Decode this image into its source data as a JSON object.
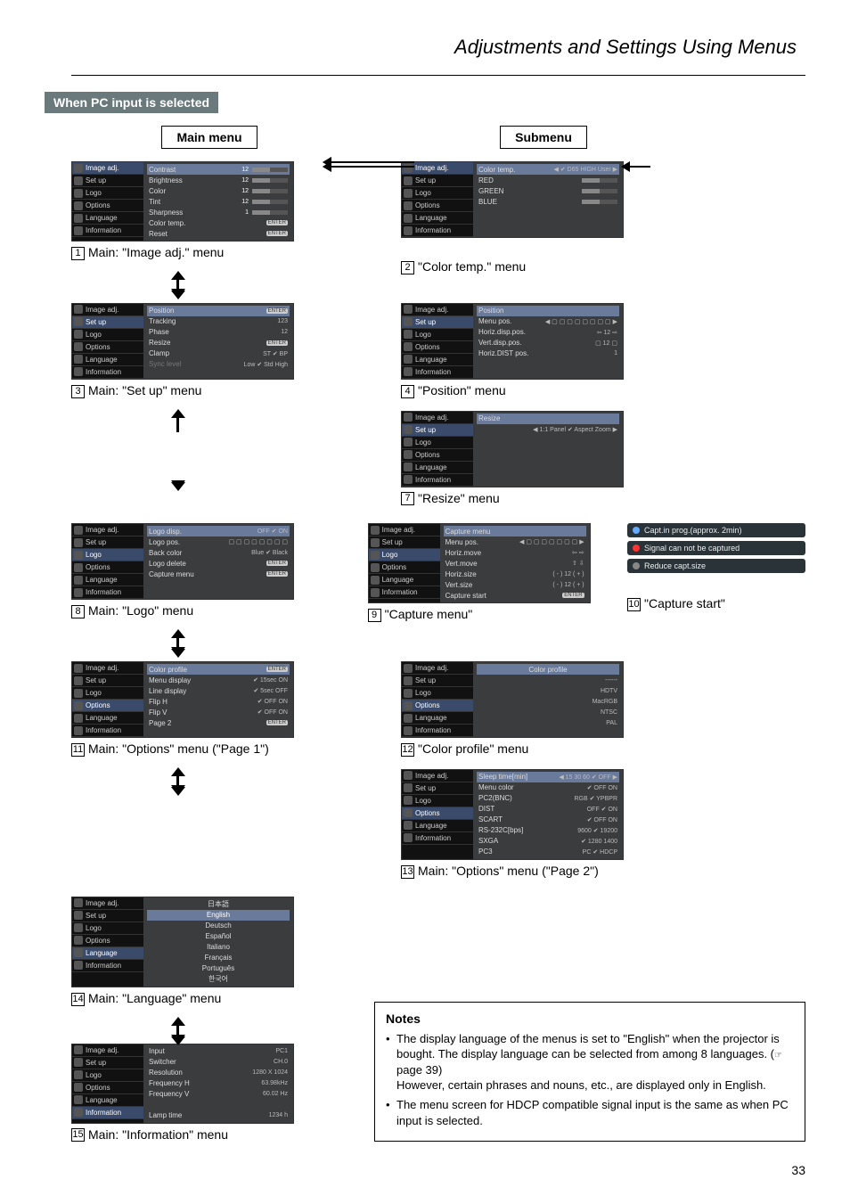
{
  "doc": {
    "header_title": "Adjustments and Settings Using Menus",
    "section": "When PC input is selected",
    "main_menu_label": "Main menu",
    "submenu_label": "Submenu",
    "page_number": "33"
  },
  "sidebar_items": [
    "Image adj.",
    "Set up",
    "Logo",
    "Options",
    "Language",
    "Information"
  ],
  "panels": {
    "p1": {
      "cap": "Main: \"Image adj.\" menu",
      "sel": 0,
      "rows": [
        {
          "l": "Contrast",
          "v": "12",
          "bar": true,
          "sel": true
        },
        {
          "l": "Brightness",
          "v": "12",
          "bar": true
        },
        {
          "l": "Color",
          "v": "12",
          "bar": true
        },
        {
          "l": "Tint",
          "v": "12",
          "bar": true
        },
        {
          "l": "Sharpness",
          "v": "1",
          "bar": true
        },
        {
          "l": "Color temp.",
          "v": "ENTER",
          "enter": true
        },
        {
          "l": "Reset",
          "v": "ENTER",
          "enter": true
        }
      ]
    },
    "p2": {
      "cap": "\"Color temp.\" menu",
      "sel": 0,
      "rows": [
        {
          "l": "Color temp.",
          "v": "◀ ✔ D65   HIGH   User ▶",
          "sel": true
        },
        {
          "l": "RED",
          "bar": true
        },
        {
          "l": "GREEN",
          "bar": true
        },
        {
          "l": "BLUE",
          "bar": true
        }
      ]
    },
    "p3": {
      "cap": "Main: \"Set up\" menu",
      "sel": 1,
      "rows": [
        {
          "l": "Position",
          "v": "ENTER",
          "enter": true,
          "sel": true
        },
        {
          "l": "Tracking",
          "v": "123"
        },
        {
          "l": "Phase",
          "v": "12"
        },
        {
          "l": "Resize",
          "v": "ENTER",
          "enter": true
        },
        {
          "l": "Clamp",
          "v": "  ST  ✔ BP"
        },
        {
          "l": "Sync level",
          "v": "Low ✔ Std   High",
          "dim": true
        }
      ]
    },
    "p4": {
      "cap": "\"Position\" menu",
      "sel": 1,
      "rows": [
        {
          "l": "Position",
          "sel": true
        },
        {
          "l": "Menu pos.",
          "v": "◀ ▢ ▢ ▢ ▢ ▢ ▢ ▢ ▢ ▶"
        },
        {
          "l": "Horiz.disp.pos.",
          "v": "⇦    12    ⇨"
        },
        {
          "l": "Vert.disp.pos.",
          "v": "▢    12    ▢"
        },
        {
          "l": "Horiz.DIST pos.",
          "v": "1"
        }
      ]
    },
    "p7": {
      "cap": "\"Resize\" menu",
      "sel": 1,
      "rows": [
        {
          "l": "Resize",
          "sel": true
        },
        {
          "l": "",
          "v": "◀   1:1   Panel ✔ Aspect   Zoom ▶"
        }
      ]
    },
    "p8": {
      "cap": "Main: \"Logo\" menu",
      "sel": 2,
      "rows": [
        {
          "l": "Logo disp.",
          "v": "OFF ✔ ON",
          "sel": true
        },
        {
          "l": "Logo pos.",
          "v": "▢ ▢ ▢ ▢ ▢ ▢ ▢ ▢"
        },
        {
          "l": "Back color",
          "v": "Blue ✔ Black"
        },
        {
          "l": "Logo delete",
          "v": "ENTER",
          "enter": true
        },
        {
          "l": "Capture menu",
          "v": "ENTER",
          "enter": true
        }
      ]
    },
    "p9": {
      "cap": "\"Capture menu\"",
      "sel": 2,
      "rows": [
        {
          "l": "Capture menu",
          "sel": true
        },
        {
          "l": "Menu pos.",
          "v": "◀ ▢ ▢ ▢ ▢ ▢ ▢ ▢ ▶"
        },
        {
          "l": "Horiz.move",
          "v": "⇦            ⇨"
        },
        {
          "l": "Vert.move",
          "v": "⇧            ⇩"
        },
        {
          "l": "Horiz.size",
          "v": "( - )    12    ( + )"
        },
        {
          "l": "Vert.size",
          "v": "( - )    12    ( + )"
        },
        {
          "l": "Capture start",
          "v": "ENTER",
          "enter": true
        }
      ]
    },
    "p10": {
      "cap": "\"Capture start\"",
      "popups": [
        {
          "dot": "p",
          "t": "Capt.in prog.(approx. 2min)"
        },
        {
          "dot": "r",
          "t": "Signal can not be captured"
        },
        {
          "dot": "g",
          "t": "Reduce capt.size"
        }
      ]
    },
    "p11": {
      "cap": "Main: \"Options\" menu (\"Page 1\")",
      "sel": 3,
      "rows": [
        {
          "l": "Color profile",
          "v": "ENTER",
          "enter": true,
          "sel": true
        },
        {
          "l": "Menu display",
          "v": "✔ 15sec    ON"
        },
        {
          "l": "Line display",
          "v": "✔ 5sec    OFF"
        },
        {
          "l": "Flip H",
          "v": "✔ OFF    ON"
        },
        {
          "l": "Flip V",
          "v": "✔ OFF    ON"
        },
        {
          "l": "Page 2",
          "v": "ENTER",
          "enter": true
        }
      ]
    },
    "p12": {
      "cap": "\"Color profile\" menu",
      "sel": 3,
      "rows": [
        {
          "l": "Color profile",
          "sel": true
        },
        {
          "l": "",
          "v": "------"
        },
        {
          "l": "",
          "v": "HDTV"
        },
        {
          "l": "",
          "v": "MacRGB"
        },
        {
          "l": "",
          "v": "NTSC"
        },
        {
          "l": "",
          "v": "PAL"
        }
      ]
    },
    "p13": {
      "cap": "Main: \"Options\" menu (\"Page 2\")",
      "sel": 3,
      "rows": [
        {
          "l": "Sleep time[min]",
          "v": "◀  15  30  60 ✔ OFF ▶",
          "sel": true
        },
        {
          "l": "Menu color",
          "v": "✔ OFF    ON"
        },
        {
          "l": "PC2(BNC)",
          "v": "  RGB  ✔ YPBPR"
        },
        {
          "l": "DIST",
          "v": "  OFF  ✔ ON"
        },
        {
          "l": "SCART",
          "v": "✔ OFF    ON"
        },
        {
          "l": "RS-232C[bps]",
          "v": "  9600 ✔ 19200"
        },
        {
          "l": "SXGA",
          "v": "✔ 1280    1400"
        },
        {
          "l": "PC3",
          "v": "  PC   ✔ HDCP"
        }
      ]
    },
    "p14": {
      "cap": "Main: \"Language\" menu",
      "sel": 4,
      "rows": [
        {
          "l": "日本語"
        },
        {
          "l": "English",
          "selrow": true
        },
        {
          "l": "Deutsch"
        },
        {
          "l": "Español"
        },
        {
          "l": "Italiano"
        },
        {
          "l": "Français"
        },
        {
          "l": "Português"
        },
        {
          "l": "한국어"
        }
      ]
    },
    "p15": {
      "cap": "Main: \"Information\" menu",
      "sel": 5,
      "rows": [
        {
          "l": "Input",
          "v": "PC1"
        },
        {
          "l": "Switcher",
          "v": "CH.0"
        },
        {
          "l": "Resolution",
          "v": "1280 X 1024"
        },
        {
          "l": "Frequency H",
          "v": "63.98kHz"
        },
        {
          "l": "Frequency V",
          "v": "60.02 Hz"
        },
        {
          "l": "",
          "v": ""
        },
        {
          "l": "Lamp time",
          "v": "1234 h"
        }
      ]
    }
  },
  "nums": {
    "n1": "1",
    "n2": "2",
    "n3": "3",
    "n4": "4",
    "n7": "7",
    "n8": "8",
    "n9": "9",
    "n10": "10",
    "n11": "11",
    "n12": "12",
    "n13": "13",
    "n14": "14",
    "n15": "15"
  },
  "notes": {
    "title": "Notes",
    "n1a": "The display language of the menus is set to \"English\" when the projector is bought. The display language can be selected from among 8 languages. (",
    "n1b": " page 39)",
    "n1c": "However, certain phrases and nouns, etc., are displayed only in English.",
    "n2": "The menu screen for HDCP compatible signal input is the same as when PC input is selected."
  }
}
